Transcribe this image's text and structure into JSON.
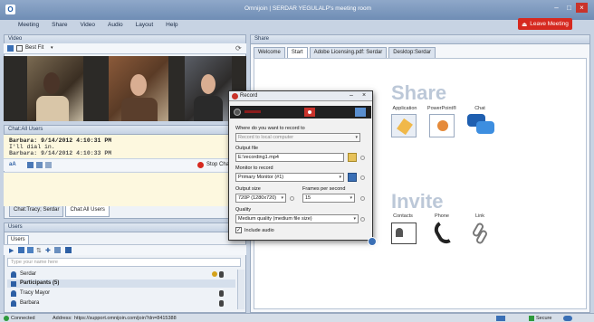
{
  "window": {
    "title": "Omnijoin | SERDAR YEGULALP's meeting room",
    "leave_button": "Leave Meeting"
  },
  "menu": [
    "Meeting",
    "Share",
    "Video",
    "Audio",
    "Layout",
    "Help"
  ],
  "video": {
    "header": "Video",
    "fit_label": "Best Fit"
  },
  "chat": {
    "header": "Chat:All Users",
    "messages": [
      {
        "line": "Barbara: 9/14/2012 4:10:31 PM"
      },
      {
        "line": "I'll dial in."
      },
      {
        "line": "Barbara: 9/14/2012 4:10:33 PM"
      }
    ],
    "stop_label": "Stop Cha",
    "tabs": [
      "Chat:Tracy; Serdar",
      "Chat:All Users"
    ]
  },
  "users": {
    "header": "Users",
    "tab": "Users",
    "search_placeholder": "Type your name here",
    "host": "Serdar",
    "group_label": "Participants (5)",
    "participants": [
      "Tracy Mayor",
      "Barbara"
    ]
  },
  "share": {
    "header": "Share",
    "tabs": [
      "Welcome",
      "Start",
      "Adobe Licensing.pdf: Serdar",
      "Desktop:Serdar"
    ],
    "active_tab": 1,
    "share_title": "Share",
    "share_items": [
      "Application",
      "PowerPoint®",
      "Chat"
    ],
    "invite_title": "Invite",
    "invite_items": [
      "Contacts",
      "Phone",
      "Link"
    ]
  },
  "record": {
    "title": "Record",
    "where_label": "Where do you want to record to",
    "where_value": "Record to local computer",
    "output_label": "Output file",
    "output_value": "E:\\recording1.mp4",
    "monitor_label": "Monitor to record",
    "monitor_value": "Primary Monitor (#1)",
    "size_label": "Output size",
    "size_value": "720P (1280x720)",
    "fps_label": "Frames per second",
    "fps_value": "15",
    "quality_label": "Quality",
    "quality_value": "Medium quality (medium file size)",
    "audio_label": "Include audio",
    "audio_checked": true
  },
  "status": {
    "connected": "Connected",
    "address_label": "Address:",
    "address": "https://support.omnijoin.com/join?dn=8415388",
    "secure": "Secure"
  },
  "colors": {
    "leave_red": "#d6291f",
    "accent_blue": "#1e5aa8"
  }
}
